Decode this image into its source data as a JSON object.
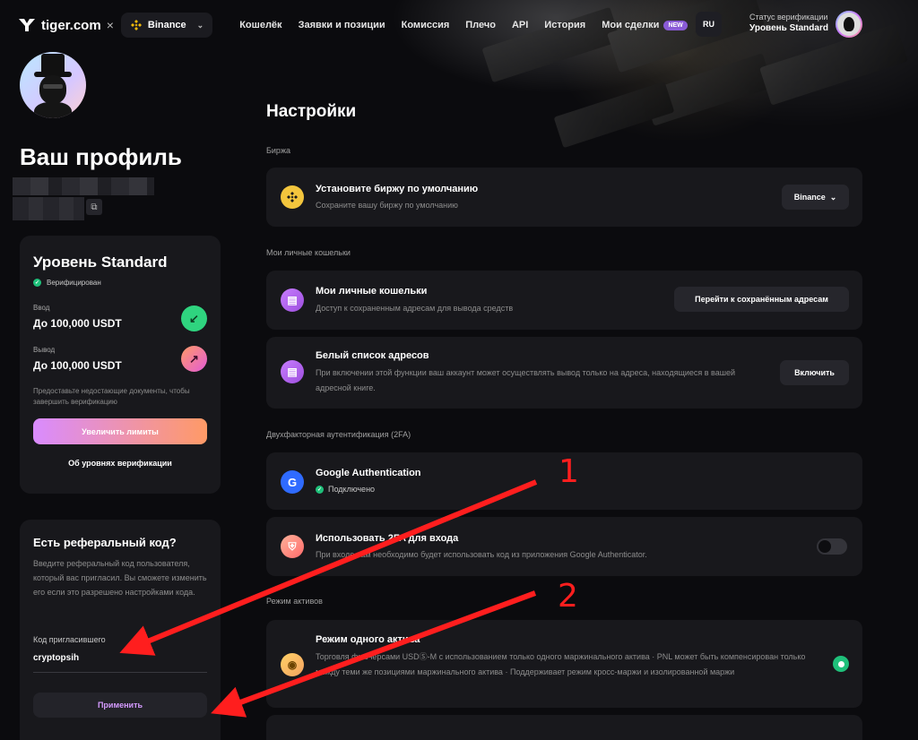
{
  "header": {
    "brand": "tiger.com",
    "separator": "×",
    "exchange": "Binance",
    "nav": [
      "Кошелёк",
      "Заявки и позиции",
      "Комиссия",
      "Плечо",
      "API",
      "История",
      "Мои сделки"
    ],
    "new_badge": "NEW",
    "lang": "RU",
    "verification_caption": "Статус верификации",
    "verification_level": "Уровень Standard"
  },
  "profile": {
    "title": "Ваш профиль"
  },
  "level_card": {
    "title": "Уровень Standard",
    "verified": "Верифицирован",
    "deposit_label": "Ввод",
    "deposit_value": "До 100,000 USDT",
    "withdraw_label": "Вывод",
    "withdraw_value": "До 100,000 USDT",
    "note": "Предоставьте недостающие документы, чтобы завершить верификацию",
    "raise_button": "Увеличить лимиты",
    "levels_link": "Об уровнях верификации"
  },
  "referral": {
    "title": "Есть реферальный код?",
    "description": "Введите реферальный код пользователя, который вас пригласил. Вы сможете изменить его если это разрешено настройками кода.",
    "label": "Код пригласившего",
    "value": "cryptopsih",
    "apply_button": "Применить"
  },
  "settings": {
    "title": "Настройки",
    "sections": {
      "exchange": "Биржа",
      "wallets": "Мои личные кошельки",
      "twofa": "Двухфакторная аутентификация (2FA)",
      "assets": "Режим активов"
    },
    "default_exchange": {
      "title": "Установите биржу по умолчанию",
      "subtitle": "Сохраните вашу биржу по умолчанию",
      "button": "Binance"
    },
    "wallets_row": {
      "title": "Мои личные кошельки",
      "subtitle": "Доступ к сохраненным адресам для вывода средств",
      "button": "Перейти к сохранённым адресам"
    },
    "whitelist": {
      "title": "Белый список адресов",
      "subtitle": "При включении этой функции ваш аккаунт может осуществлять вывод только на адреса, находящиеся в вашей адресной книге.",
      "button": "Включить"
    },
    "google_auth": {
      "title": "Google Authentication",
      "status": "Подключено"
    },
    "login_2fa": {
      "title": "Использовать 2FA для входа",
      "subtitle": "При входе вам необходимо будет использовать код из приложения Google Authenticator.",
      "enabled": false
    },
    "single_asset": {
      "title": "Режим одного актива",
      "subtitle": "Торговля фьючерсами USDⓈ-M с использованием только одного маржинального актива · PNL может быть компенсирован только между теми же позициями маржинального актива · Поддерживает режим кросс-маржи и изолированной маржи",
      "selected": true
    }
  },
  "annotations": {
    "label_1": "1",
    "label_2": "2",
    "color": "#ff1e1e"
  }
}
